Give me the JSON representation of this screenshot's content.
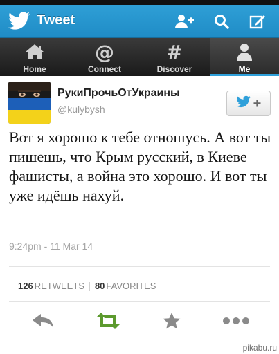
{
  "appbar": {
    "title": "Tweet",
    "colors": {
      "bar": "#2195cf"
    },
    "icons": {
      "logo": "twitter-bird-icon",
      "add_user": "add-user-icon",
      "search": "search-icon",
      "compose": "compose-icon"
    }
  },
  "tabs": [
    {
      "label": "Home",
      "icon": "home-icon"
    },
    {
      "label": "Connect",
      "icon": "at-sign-icon"
    },
    {
      "label": "Discover",
      "icon": "hashtag-icon"
    },
    {
      "label": "Me",
      "icon": "person-icon",
      "active": true
    }
  ],
  "tweet": {
    "author_name": "РукиПрочьОтУкраины",
    "author_handle": "@kulybysh",
    "text": "Вот я хорошо к тебе отношусь. А вот ты пишешь, что Крым русский, в Киеве фашисты, а война это хорошо. И вот ты уже идёшь нахуй.",
    "timestamp": "9:24pm - 11 Mar 14",
    "retweets_count": "126",
    "retweets_label": "RETWEETS",
    "favorites_count": "80",
    "favorites_label": "FAVORITES"
  },
  "actions": [
    {
      "name": "reply",
      "icon": "reply-icon",
      "color": "#8a8a8a"
    },
    {
      "name": "retweet",
      "icon": "retweet-icon",
      "color": "#5c9a2e"
    },
    {
      "name": "favorite",
      "icon": "star-icon",
      "color": "#8a8a8a"
    },
    {
      "name": "more",
      "icon": "more-icon",
      "color": "#8a8a8a"
    }
  ],
  "watermark": "pikabu.ru",
  "colors": {
    "accent": "#2fa0da",
    "retweet_active": "#5c9a2e",
    "avatar_blue": "#1d5fb8",
    "avatar_yellow": "#f3d21a"
  }
}
